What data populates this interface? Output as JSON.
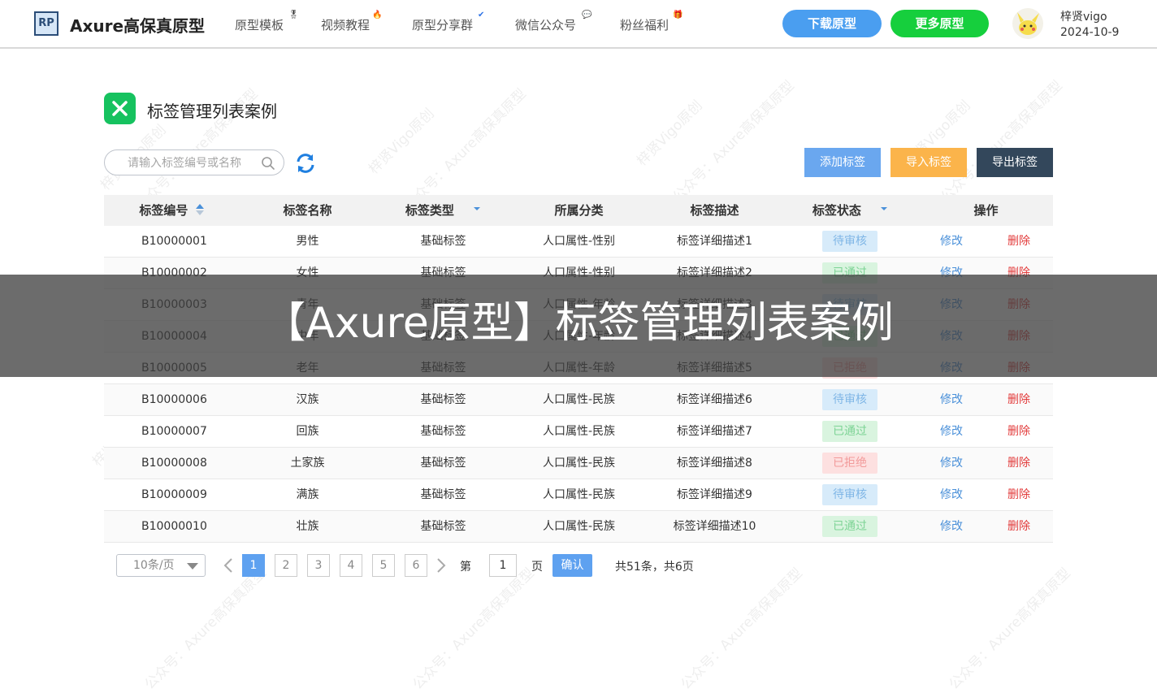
{
  "header": {
    "logo_text": "RP",
    "brand": "Axure高保真原型",
    "nav": [
      {
        "label": "原型模板",
        "badge": "🎖"
      },
      {
        "label": "视频教程",
        "badge": "🔥"
      },
      {
        "label": "原型分享群",
        "badge": "✔"
      },
      {
        "label": "微信公众号",
        "badge": "💬"
      },
      {
        "label": "粉丝福利",
        "badge": "🎁"
      }
    ],
    "download_button": "下载原型",
    "more_button": "更多原型",
    "user_name": "梓贤vigo",
    "user_date": "2024-10-9",
    "colors": {
      "download": "#4a9ef0",
      "more": "#16cf3d"
    }
  },
  "watermark": {
    "line1": "梓贤Vigo原创",
    "line2": "公众号：Axure高保真原型"
  },
  "page": {
    "title": "标签管理列表案例",
    "icon": "close-x-icon"
  },
  "toolbar": {
    "search_placeholder": "请输入标签编号或名称",
    "add_label": "添加标签",
    "import_label": "导入标签",
    "export_label": "导出标签",
    "colors": {
      "add": "#6aa7ef",
      "import": "#fbb44b",
      "export": "#33475b"
    }
  },
  "table": {
    "columns": [
      "标签编号",
      "标签名称",
      "标签类型",
      "所属分类",
      "标签描述",
      "标签状态",
      "操作"
    ],
    "edit_label": "修改",
    "delete_label": "删除",
    "rows": [
      {
        "id": "B10000001",
        "name": "男性",
        "type": "基础标签",
        "category": "人口属性-性别",
        "desc": "标签详细描述1",
        "status": "待审核"
      },
      {
        "id": "B10000002",
        "name": "女性",
        "type": "基础标签",
        "category": "人口属性-性别",
        "desc": "标签详细描述2",
        "status": "已通过"
      },
      {
        "id": "B10000003",
        "name": "青年",
        "type": "基础标签",
        "category": "人口属性-年龄",
        "desc": "标签详细描述3",
        "status": "待审核"
      },
      {
        "id": "B10000004",
        "name": "中年",
        "type": "基础标签",
        "category": "人口属性-年龄",
        "desc": "标签详细描述4",
        "status": "已通过"
      },
      {
        "id": "B10000005",
        "name": "老年",
        "type": "基础标签",
        "category": "人口属性-年龄",
        "desc": "标签详细描述5",
        "status": "已拒绝"
      },
      {
        "id": "B10000006",
        "name": "汉族",
        "type": "基础标签",
        "category": "人口属性-民族",
        "desc": "标签详细描述6",
        "status": "待审核"
      },
      {
        "id": "B10000007",
        "name": "回族",
        "type": "基础标签",
        "category": "人口属性-民族",
        "desc": "标签详细描述7",
        "status": "已通过"
      },
      {
        "id": "B10000008",
        "name": "土家族",
        "type": "基础标签",
        "category": "人口属性-民族",
        "desc": "标签详细描述8",
        "status": "已拒绝"
      },
      {
        "id": "B10000009",
        "name": "满族",
        "type": "基础标签",
        "category": "人口属性-民族",
        "desc": "标签详细描述9",
        "status": "待审核"
      },
      {
        "id": "B10000010",
        "name": "壮族",
        "type": "基础标签",
        "category": "人口属性-民族",
        "desc": "标签详细描述10",
        "status": "已通过"
      }
    ],
    "status_styles": {
      "待审核": {
        "bg": "#d7ebfa",
        "fg": "#7fb6e6"
      },
      "已通过": {
        "bg": "#d9f4df",
        "fg": "#7dd395"
      },
      "已拒绝": {
        "bg": "#fde0e0",
        "fg": "#f29a9a"
      }
    }
  },
  "pager": {
    "page_size": "10条/页",
    "pages": [
      "1",
      "2",
      "3",
      "4",
      "5",
      "6"
    ],
    "current": "1",
    "goto_prefix": "第",
    "goto_value": "1",
    "goto_suffix": "页",
    "confirm": "确认",
    "summary": "共51条，共6页"
  },
  "overlay": {
    "text": "【Axure原型】标签管理列表案例"
  }
}
